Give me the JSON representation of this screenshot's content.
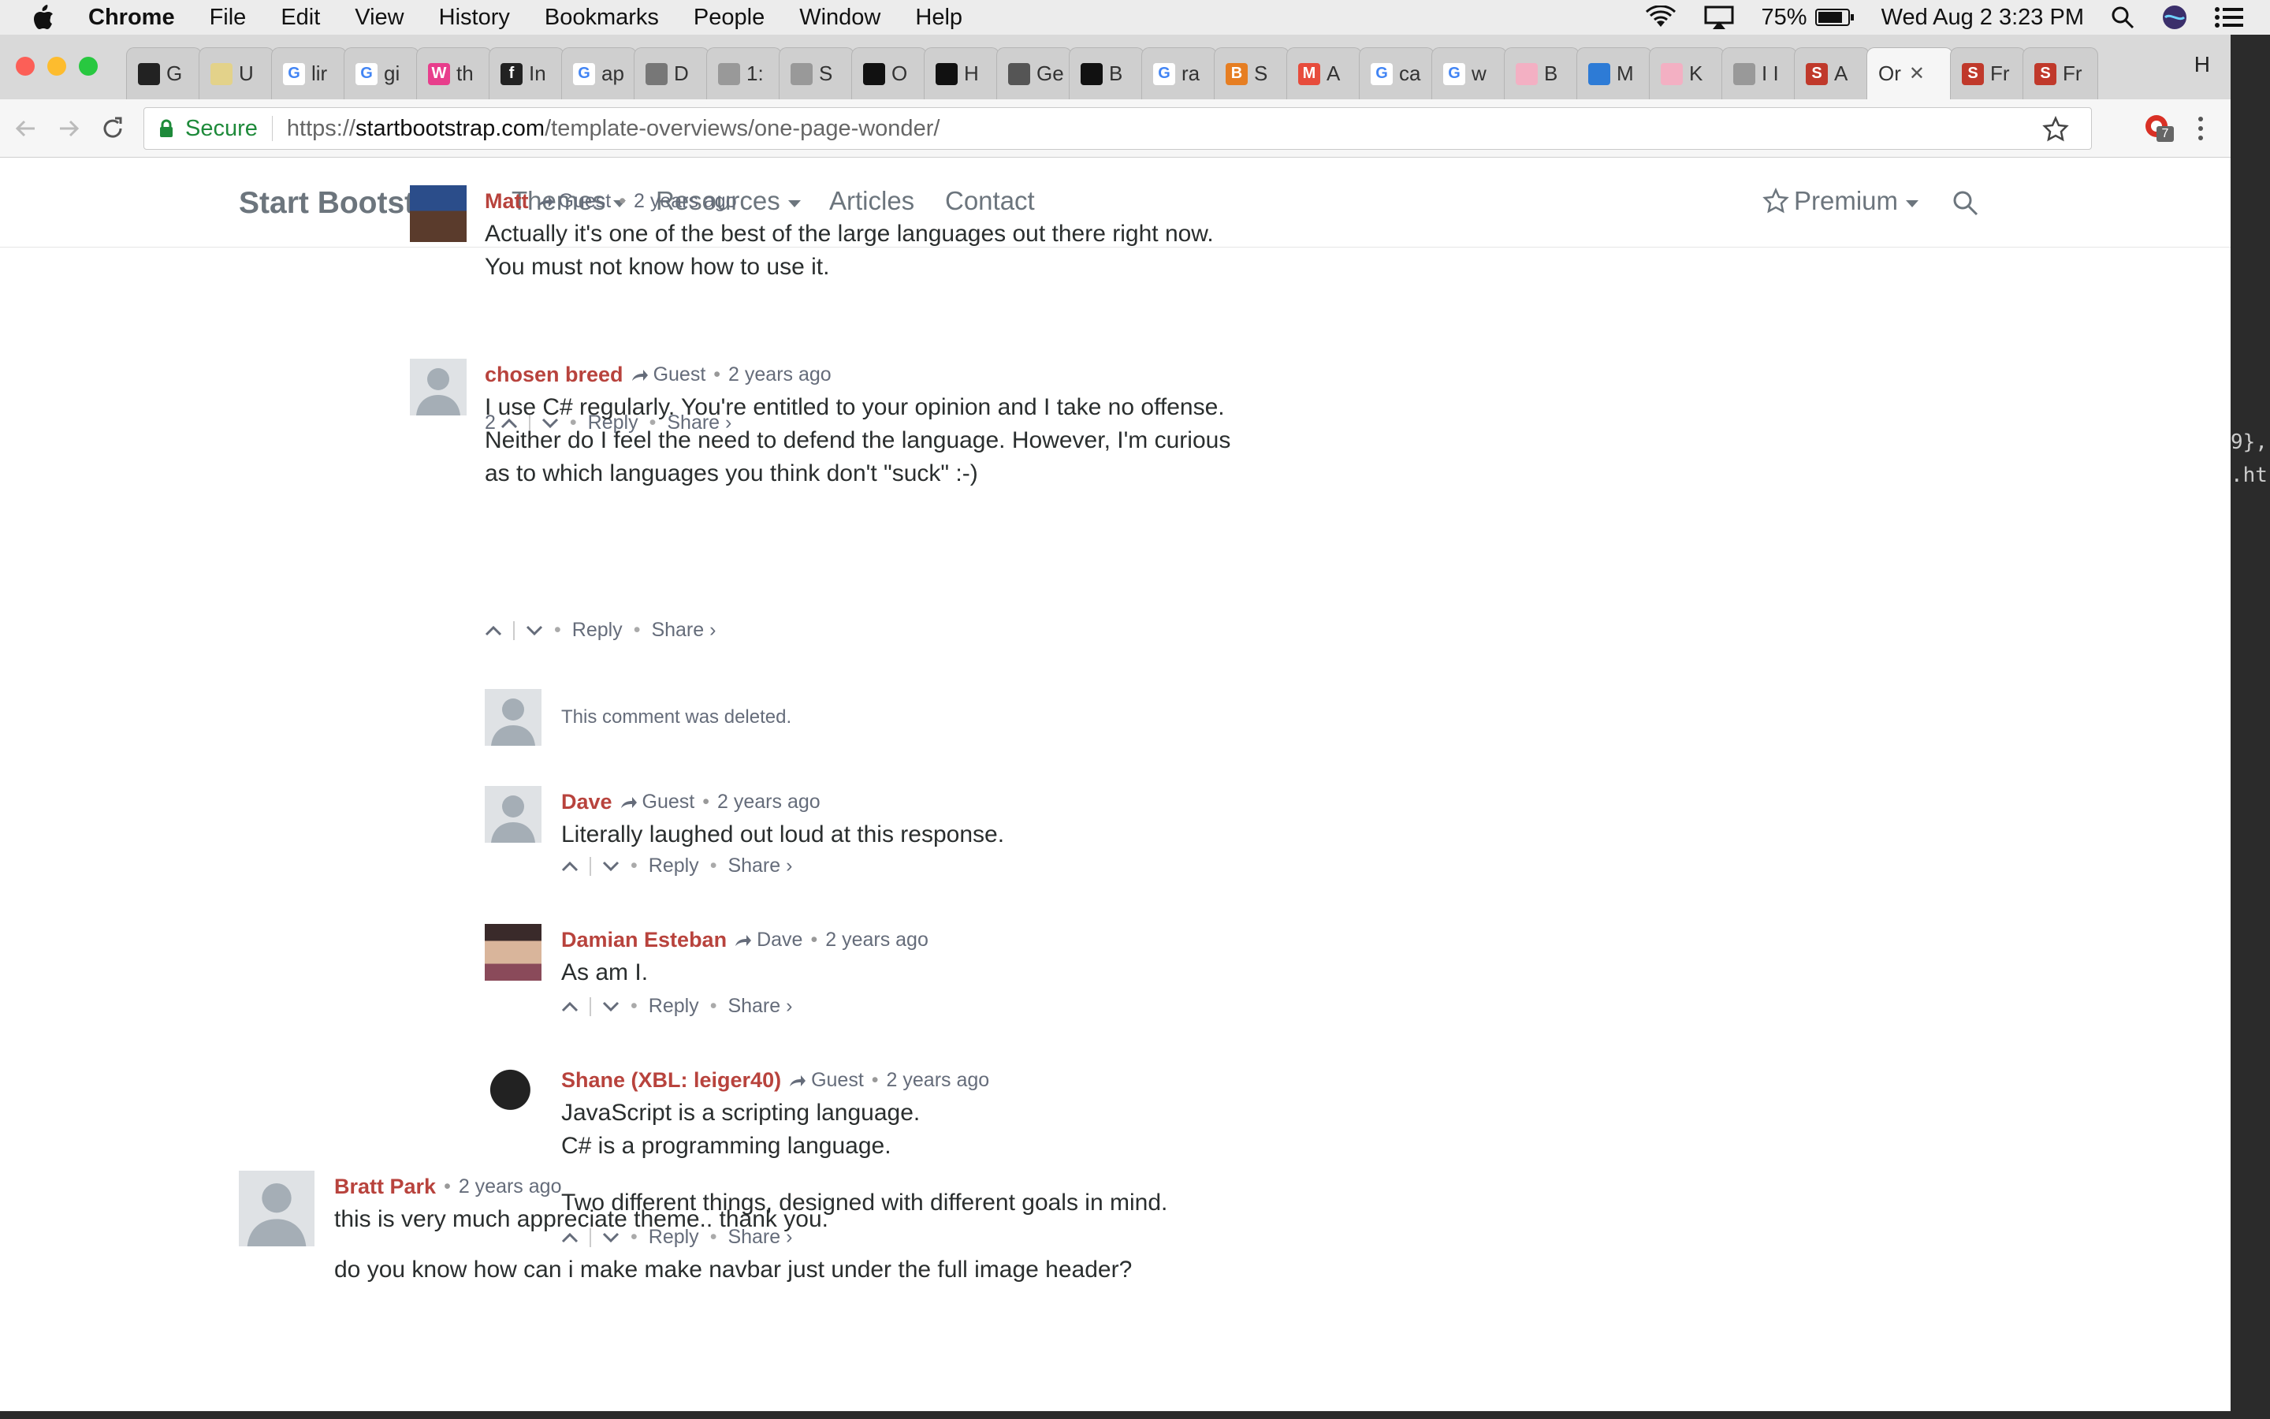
{
  "menubar": {
    "app": "Chrome",
    "items": [
      "File",
      "Edit",
      "View",
      "History",
      "Bookmarks",
      "People",
      "Window",
      "Help"
    ],
    "battery": "75%",
    "clock": "Wed Aug 2  3:23 PM"
  },
  "tabs": [
    {
      "label": "G",
      "icon": "github-icon",
      "color": "#222222",
      "glyph": ""
    },
    {
      "label": "U",
      "icon": "folder-icon",
      "color": "#e3d28a",
      "glyph": ""
    },
    {
      "label": "lir",
      "icon": "google-icon",
      "color": "#4285f4",
      "glyph": "G"
    },
    {
      "label": "gi",
      "icon": "google-icon",
      "color": "#4285f4",
      "glyph": "G"
    },
    {
      "label": "th",
      "icon": "w-icon",
      "color": "#e83e8c",
      "glyph": "W"
    },
    {
      "label": "In",
      "icon": "f-icon",
      "color": "#222222",
      "glyph": "f"
    },
    {
      "label": "ap",
      "icon": "google-icon",
      "color": "#4285f4",
      "glyph": "G"
    },
    {
      "label": "D",
      "icon": "book-icon",
      "color": "#777777",
      "glyph": ""
    },
    {
      "label": "1:",
      "icon": "page-icon",
      "color": "#999999",
      "glyph": ""
    },
    {
      "label": "S",
      "icon": "page-icon",
      "color": "#999999",
      "glyph": ""
    },
    {
      "label": "O",
      "icon": "cat-icon",
      "color": "#111111",
      "glyph": ""
    },
    {
      "label": "H",
      "icon": "cat-icon",
      "color": "#111111",
      "glyph": ""
    },
    {
      "label": "Ge",
      "icon": "speaker-icon",
      "color": "#555555",
      "glyph": ""
    },
    {
      "label": "B",
      "icon": "cat-icon",
      "color": "#111111",
      "glyph": ""
    },
    {
      "label": "ra",
      "icon": "google-icon",
      "color": "#4285f4",
      "glyph": "G"
    },
    {
      "label": "S",
      "icon": "b-icon",
      "color": "#e67e22",
      "glyph": "B"
    },
    {
      "label": "A",
      "icon": "m-icon",
      "color": "#e74c3c",
      "glyph": "M"
    },
    {
      "label": "ca",
      "icon": "google-icon",
      "color": "#4285f4",
      "glyph": "G"
    },
    {
      "label": "w",
      "icon": "google-icon",
      "color": "#4285f4",
      "glyph": "G"
    },
    {
      "label": "B",
      "icon": "stripes-icon",
      "color": "#f3b0c3",
      "glyph": ""
    },
    {
      "label": "M",
      "icon": "plane-icon",
      "color": "#2d7bd6",
      "glyph": ""
    },
    {
      "label": "K",
      "icon": "stripes-icon",
      "color": "#f3b0c3",
      "glyph": ""
    },
    {
      "label": "I I",
      "icon": "page-icon",
      "color": "#999999",
      "glyph": ""
    },
    {
      "label": "A",
      "icon": "s-icon",
      "color": "#c0392b",
      "glyph": "S"
    },
    {
      "label": "Or",
      "icon": "none",
      "color": "#f6f6f6",
      "glyph": "",
      "active": true
    },
    {
      "label": "Fr",
      "icon": "s-icon",
      "color": "#c0392b",
      "glyph": "S"
    },
    {
      "label": "Fr",
      "icon": "s-icon",
      "color": "#c0392b",
      "glyph": "S"
    }
  ],
  "profile_letter": "H",
  "omnibox": {
    "secure": "Secure",
    "scheme": "https://",
    "host": "startbootstrap.com",
    "path": "/template-overviews/one-page-wonder/"
  },
  "extension_badge": "7",
  "site": {
    "brand": "Start Bootstrap",
    "nav": [
      "Themes",
      "Resources",
      "Articles",
      "Contact"
    ],
    "premium": "Premium"
  },
  "comments": [
    {
      "author": "Matt",
      "reply_to": "Guest",
      "time": "2 years ago",
      "lines": [
        "Actually it's one of the best of the large languages out there right now.",
        "You must not know how to use it."
      ],
      "votes": "2"
    },
    {
      "author": "chosen breed",
      "reply_to": "Guest",
      "time": "2 years ago",
      "lines": [
        "I use C# regularly. You're entitled to your opinion and I take no offense.",
        "Neither do I feel the need to defend the language. However, I'm curious",
        "as to which languages you think don't \"suck\" :-)"
      ],
      "votes": ""
    },
    {
      "deleted": "This comment was deleted."
    },
    {
      "author": "Dave",
      "reply_to": "Guest",
      "time": "2 years ago",
      "lines": [
        "Literally laughed out loud at this response."
      ],
      "votes": ""
    },
    {
      "author": "Damian Esteban",
      "reply_to": "Dave",
      "time": "2 years ago",
      "lines": [
        "As am I."
      ],
      "votes": ""
    },
    {
      "author": "Shane (XBL: leiger40)",
      "reply_to": "Guest",
      "time": "2 years ago",
      "lines": [
        "JavaScript is a scripting language.",
        "C# is a programming language.",
        "",
        "Two different things, designed with different goals in mind."
      ],
      "votes": ""
    },
    {
      "author": "Bratt Park",
      "reply_to": "",
      "time": "2 years ago",
      "lines": [
        "this is very much appreciate theme.. thank you.",
        "",
        "do you know how can i make make navbar just under the full image header?"
      ],
      "votes": ""
    }
  ],
  "actions": {
    "reply": "Reply",
    "share": "Share ›"
  },
  "behind_text": [
    "9},",
    ".ht"
  ],
  "colors": {
    "author": "#b8433d",
    "meta": "#656c7a",
    "secure": "#1e8a3a"
  }
}
